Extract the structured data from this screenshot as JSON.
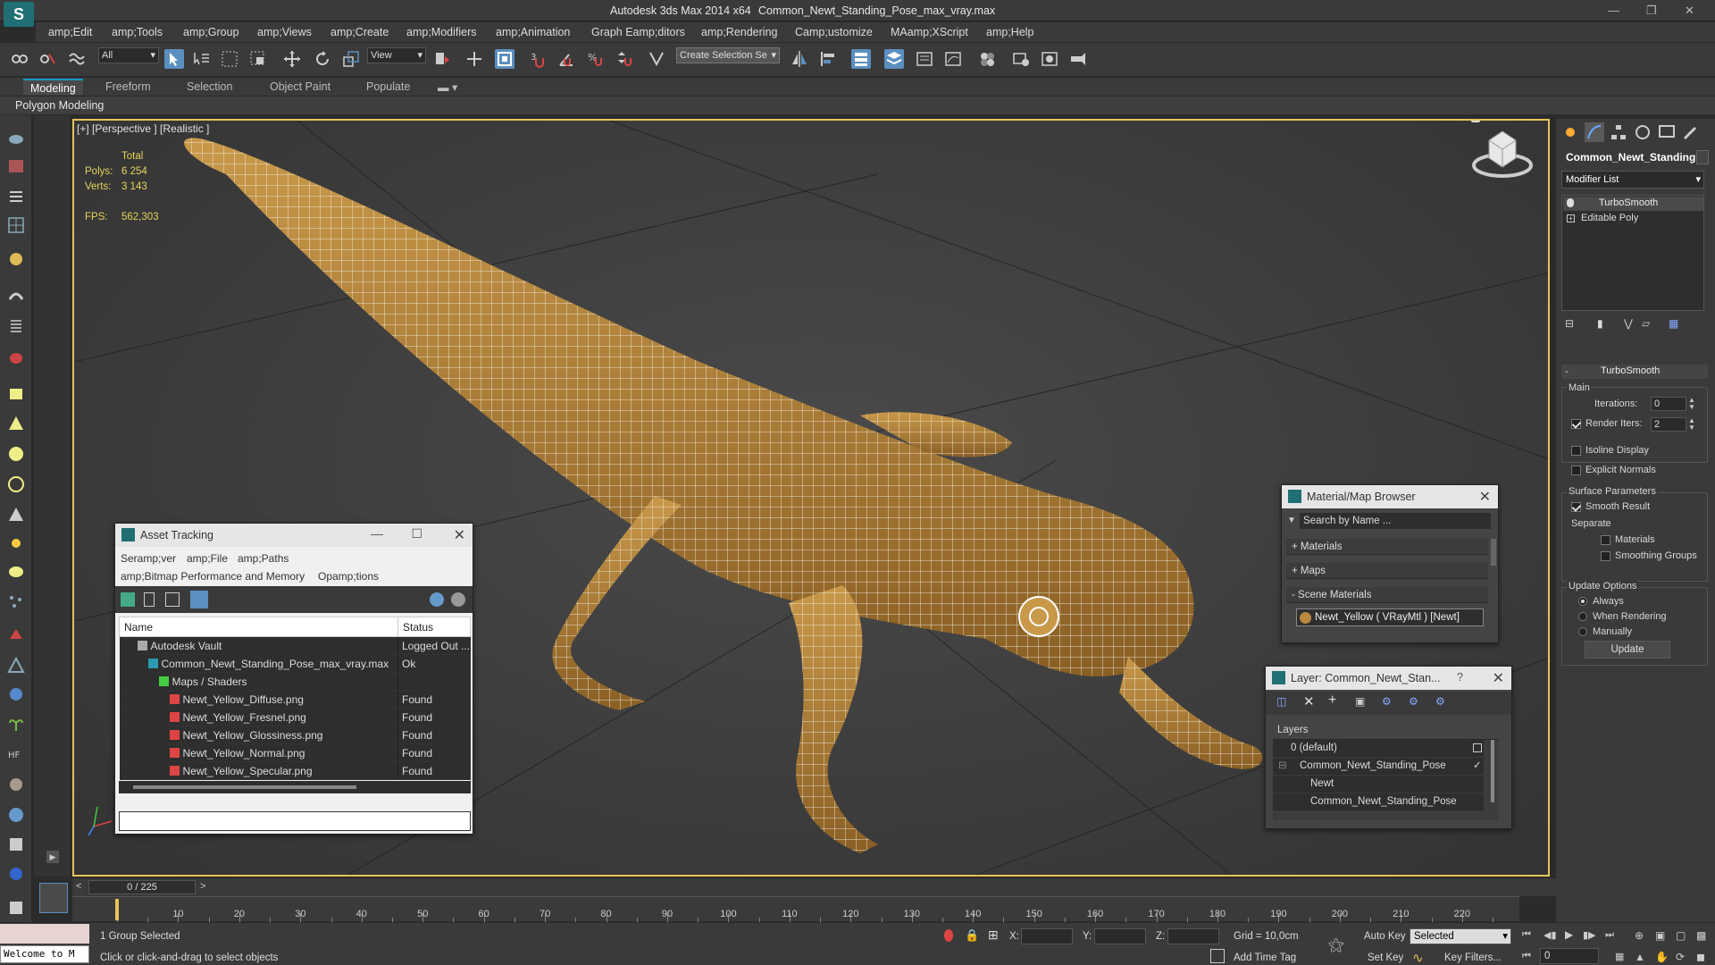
{
  "app": {
    "title": "Autodesk 3ds Max  2014 x64",
    "file": "Common_Newt_Standing_Pose_max_vray.max"
  },
  "menu": [
    "amp;Edit",
    "amp;Tools",
    "amp;Group",
    "amp;Views",
    "amp;Create",
    "amp;Modifiers",
    "amp;Animation",
    "Graph Eamp;ditors",
    "amp;Rendering",
    "Camp;ustomize",
    "MAamp;XScript",
    "amp;Help"
  ],
  "toolbar": {
    "filter_select": "All",
    "coord_select": "View",
    "selection_set": "Create Selection Se"
  },
  "ribbon": {
    "tabs": [
      "Modeling",
      "Freeform",
      "Selection",
      "Object Paint",
      "Populate"
    ],
    "active": "Modeling",
    "subpanel": "Polygon Modeling"
  },
  "viewport": {
    "label": "[+] [Perspective ] [Realistic ]",
    "stats": {
      "total_label": "Total",
      "polys_label": "Polys:",
      "polys": "6 254",
      "verts_label": "Verts:",
      "verts": "3 143",
      "fps_label": "FPS:",
      "fps": "562,303"
    }
  },
  "command_panel": {
    "object_name": "Common_Newt_Standing",
    "modifier_list": "Modifier List",
    "stack": [
      "TurboSmooth",
      "Editable Poly"
    ],
    "rollout_title": "TurboSmooth",
    "main_label": "Main",
    "iterations_label": "Iterations:",
    "iterations": "0",
    "render_iters_label": "Render Iters:",
    "render_iters": "2",
    "isoline_label": "Isoline Display",
    "explicit_normals_label": "Explicit Normals",
    "surface_params_label": "Surface Parameters",
    "smooth_result_label": "Smooth Result",
    "separate_label": "Separate",
    "materials_label": "Materials",
    "smoothing_groups_label": "Smoothing Groups",
    "update_options_label": "Update Options",
    "always_label": "Always",
    "when_rendering_label": "When Rendering",
    "manually_label": "Manually",
    "update_button": "Update"
  },
  "asset_tracking": {
    "title": "Asset Tracking",
    "menu": [
      "Seramp;ver",
      "amp;File",
      "amp;Paths",
      "amp;Bitmap Performance and Memory",
      "Opamp;tions"
    ],
    "columns": [
      "Name",
      "Status"
    ],
    "rows": [
      {
        "name": "Autodesk Vault",
        "status": "Logged Out ...",
        "indent": 1,
        "kind": "vault"
      },
      {
        "name": "Common_Newt_Standing_Pose_max_vray.max",
        "status": "Ok",
        "indent": 2,
        "kind": "max"
      },
      {
        "name": "Maps / Shaders",
        "status": "",
        "indent": 3,
        "kind": "folder"
      },
      {
        "name": "Newt_Yellow_Diffuse.png",
        "status": "Found",
        "indent": 4,
        "kind": "png"
      },
      {
        "name": "Newt_Yellow_Fresnel.png",
        "status": "Found",
        "indent": 4,
        "kind": "png"
      },
      {
        "name": "Newt_Yellow_Glossiness.png",
        "status": "Found",
        "indent": 4,
        "kind": "png"
      },
      {
        "name": "Newt_Yellow_Normal.png",
        "status": "Found",
        "indent": 4,
        "kind": "png"
      },
      {
        "name": "Newt_Yellow_Specular.png",
        "status": "Found",
        "indent": 4,
        "kind": "png"
      }
    ]
  },
  "material_browser": {
    "title": "Material/Map Browser",
    "search_placeholder": "Search by Name ...",
    "sections": [
      "+ Materials",
      "+ Maps",
      "- Scene Materials"
    ],
    "scene_material": "Newt_Yellow  ( VRayMtl )  [Newt]"
  },
  "layer_window": {
    "title": "Layer: Common_Newt_Stan...",
    "help": "?",
    "header": "Layers",
    "rows": [
      "0 (default)",
      "Common_Newt_Standing_Pose",
      "Newt",
      "Common_Newt_Standing_Pose"
    ]
  },
  "timeline": {
    "frame_counter": "0 / 225",
    "ticks": [
      "10",
      "20",
      "30",
      "40",
      "50",
      "60",
      "70",
      "80",
      "90",
      "100",
      "110",
      "120",
      "130",
      "140",
      "150",
      "160",
      "170",
      "180",
      "190",
      "200",
      "210",
      "220"
    ]
  },
  "statusbar": {
    "script_field": "Welcome to M",
    "selection_status": "1 Group Selected",
    "prompt": "Click or click-and-drag to select objects",
    "x_label": "X:",
    "y_label": "Y:",
    "z_label": "Z:",
    "grid": "Grid = 10,0cm",
    "add_time_tag": "Add Time Tag",
    "auto_key": "Auto Key",
    "set_key": "Set Key",
    "key_mode": "Selected",
    "key_filters": "Key Filters...",
    "frame": "0"
  },
  "colors": {
    "ui_bg": "#3a3a3a",
    "viewport_border": "#e6c35a",
    "stats": "#e6d35a",
    "accent": "#5a8fc0",
    "newt_body": "#b8893e"
  }
}
